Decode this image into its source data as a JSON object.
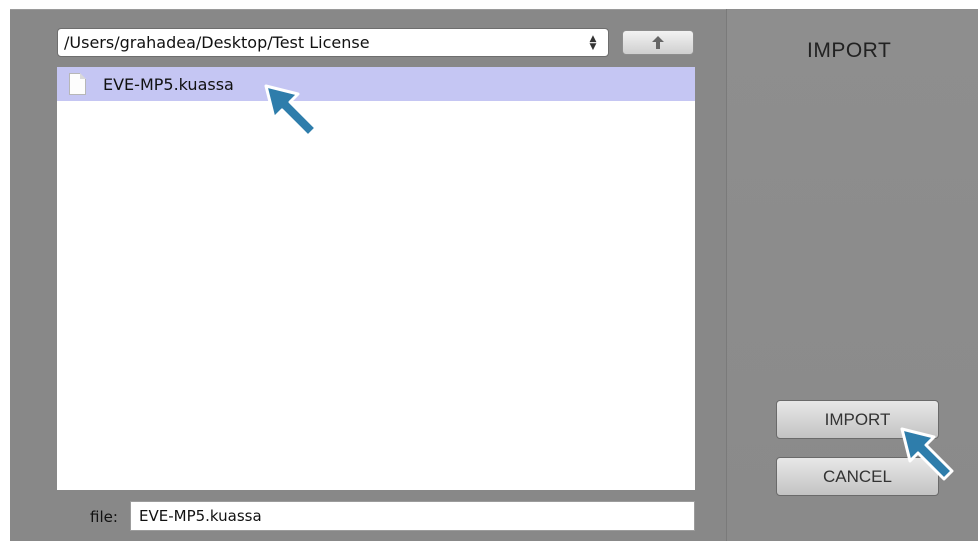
{
  "path_select": {
    "value": "/Users/grahadea/Desktop/Test License"
  },
  "up_button": {
    "icon": "up-arrow-icon"
  },
  "file_list": {
    "items": [
      {
        "name": "EVE-MP5.kuassa",
        "selected": true,
        "icon": "document-icon"
      }
    ]
  },
  "file_field": {
    "label": "file:",
    "value": "EVE-MP5.kuassa"
  },
  "side_panel": {
    "title": "IMPORT",
    "import_label": "IMPORT",
    "cancel_label": "CANCEL"
  },
  "colors": {
    "dialog_bg": "#888888",
    "selection": "#c5c6f3",
    "cursor_fill": "#2e7dab"
  }
}
